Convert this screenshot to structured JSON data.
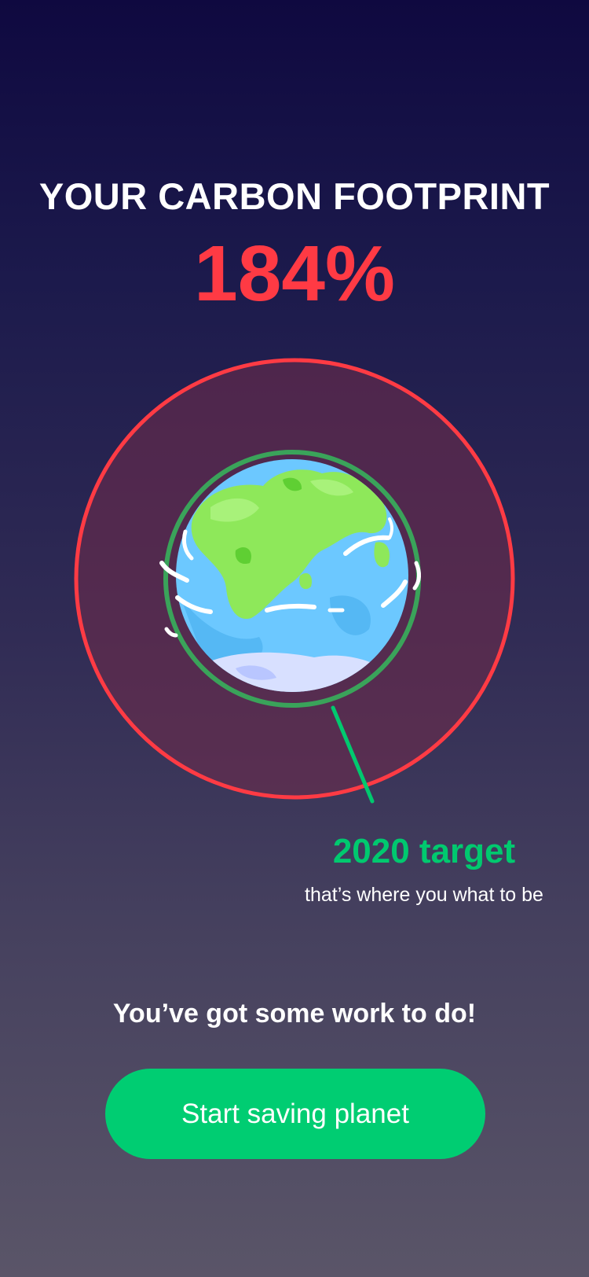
{
  "header": {
    "title": "YOUR CARBON FOOTPRINT",
    "percent": "184%"
  },
  "footprint": {
    "value_percent": 184,
    "target_percent": 100
  },
  "target": {
    "label": "2020 target",
    "subtitle": "that’s where you what to be"
  },
  "message": "You’ve got some work to do!",
  "cta": {
    "label": "Start saving planet"
  },
  "colors": {
    "accent_red": "#ff3a44",
    "accent_green": "#00c96f",
    "button_green": "#00cd72",
    "ocean": "#6cc8ff",
    "land": "#8ee85a"
  },
  "icons": {
    "earth": "earth-globe-icon"
  }
}
